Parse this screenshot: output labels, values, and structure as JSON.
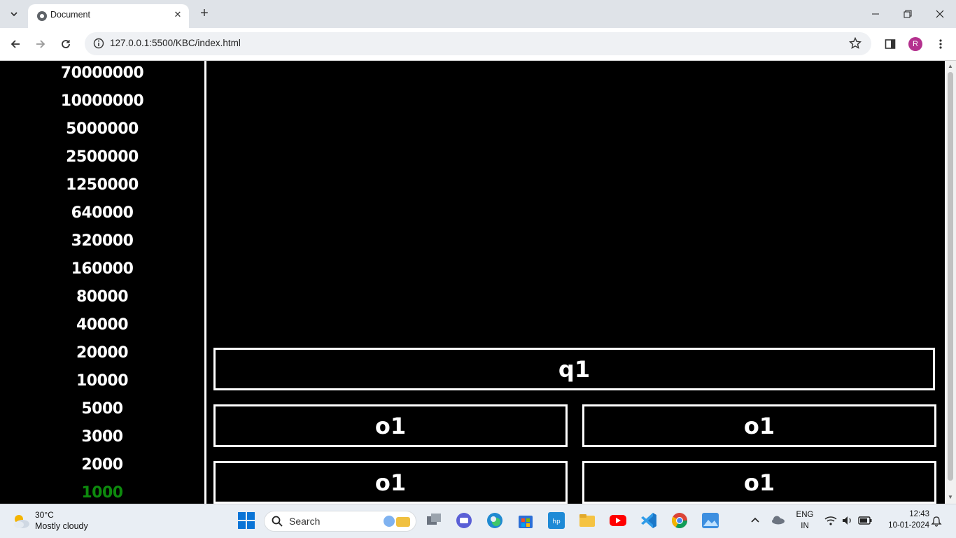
{
  "browser": {
    "tab_title": "Document",
    "url": "127.0.0.1:5500/KBC/index.html",
    "profile_initial": "R"
  },
  "prize_ladder": [
    {
      "amount": "70000000",
      "current": false
    },
    {
      "amount": "10000000",
      "current": false
    },
    {
      "amount": "5000000",
      "current": false
    },
    {
      "amount": "2500000",
      "current": false
    },
    {
      "amount": "1250000",
      "current": false
    },
    {
      "amount": "640000",
      "current": false
    },
    {
      "amount": "320000",
      "current": false
    },
    {
      "amount": "160000",
      "current": false
    },
    {
      "amount": "80000",
      "current": false
    },
    {
      "amount": "40000",
      "current": false
    },
    {
      "amount": "20000",
      "current": false
    },
    {
      "amount": "10000",
      "current": false
    },
    {
      "amount": "5000",
      "current": false
    },
    {
      "amount": "3000",
      "current": false
    },
    {
      "amount": "2000",
      "current": false
    },
    {
      "amount": "1000",
      "current": true
    }
  ],
  "question": {
    "text": "q1",
    "options": [
      "o1",
      "o1",
      "o1",
      "o1"
    ]
  },
  "colors": {
    "page_bg": "#000000",
    "border": "#ffffff",
    "current_prize": "#0d8a0d",
    "text": "#ffffff"
  },
  "taskbar": {
    "weather_temp": "30°C",
    "weather_desc": "Mostly cloudy",
    "search_label": "Search",
    "lang_top": "ENG",
    "lang_bottom": "IN",
    "time": "12:43",
    "date": "10-01-2024"
  }
}
